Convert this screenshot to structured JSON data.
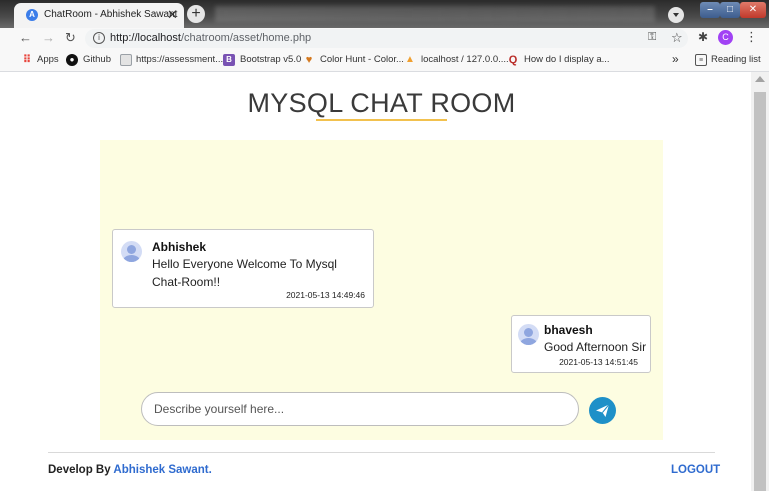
{
  "browser": {
    "tab_title": "ChatRoom - Abhishek Sawant",
    "tab_close": "✕",
    "new_tab": "+",
    "url_host": "http://localhost",
    "url_path": "/chatroom/asset/home.php",
    "avatar_initial": "C",
    "bookmarks": [
      {
        "label": "Apps",
        "icon": "apps-grid-icon",
        "color": "#e8453c"
      },
      {
        "label": "Github",
        "icon": "github-icon",
        "color": "#111111"
      },
      {
        "label": "https://assessment....",
        "icon": "page-icon",
        "color": "#9aa0a6"
      },
      {
        "label": "Bootstrap v5.0",
        "icon": "bootstrap-icon",
        "color": "#7952b3"
      },
      {
        "label": "Color Hunt - Color...",
        "icon": "color-hunt-icon",
        "color": "#d4791f"
      },
      {
        "label": "localhost / 127.0.0....",
        "icon": "phpmyadmin-icon",
        "color": "#f0a030"
      },
      {
        "label": "How do I display a...",
        "icon": "quora-icon",
        "color": "#b92b27"
      }
    ],
    "more_bookmarks": "»",
    "reading_list": "Reading list"
  },
  "page": {
    "title": "MYSQL CHAT ROOM",
    "accent_color": "#f2c14e"
  },
  "messages": [
    {
      "name": "Abhishek",
      "text": "Hello Everyone Welcome To Mysql Chat-Room!!",
      "time": "2021-05-13 14:49:46",
      "side": "left"
    },
    {
      "name": "bhavesh",
      "text": "Good Afternoon Sir",
      "time": "2021-05-13 14:51:45",
      "side": "right"
    }
  ],
  "composer": {
    "placeholder": "Describe yourself here..."
  },
  "footer": {
    "prefix": "Develop By ",
    "author": "Abhishek Sawant.",
    "logout": "LOGOUT",
    "link_color": "#2f6bcf"
  }
}
